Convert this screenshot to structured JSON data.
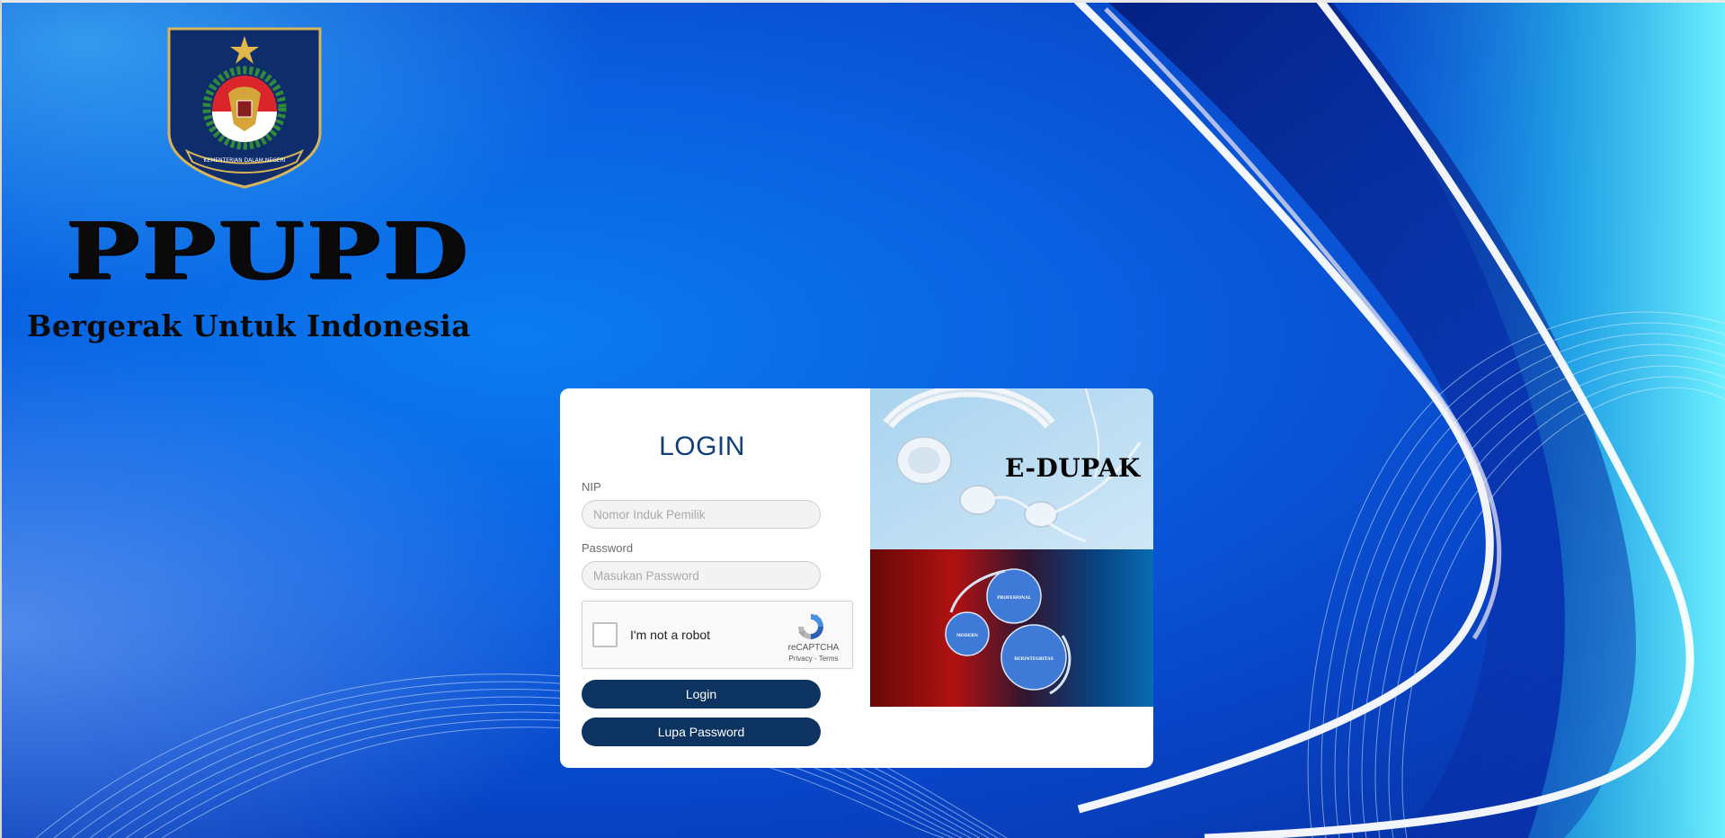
{
  "brand": {
    "title": "PPUPD",
    "subtitle": "Bergerak Untuk Indonesia",
    "emblem_text": "KEMENTERIAN DALAM NEGERI"
  },
  "login": {
    "heading": "LOGIN",
    "nip_label": "NIP",
    "nip_placeholder": "Nomor Induk Pemilik",
    "nip_value": "",
    "password_label": "Password",
    "password_placeholder": "Masukan Password",
    "password_value": "",
    "captcha": {
      "text": "I'm not a robot",
      "brand": "reCAPTCHA",
      "links": "Privacy - Terms",
      "checked": false
    },
    "login_button": "Login",
    "forgot_button": "Lupa Password"
  },
  "side_images": {
    "top_label": "E-DUPAK",
    "gear_labels": [
      "PROFESIONAL",
      "MODERN",
      "BERINTEGRITAS"
    ]
  },
  "colors": {
    "primary_button": "#0d3461",
    "heading": "#123f7a",
    "background": "#0a5fe0"
  },
  "icons": {
    "captcha_logo": "recaptcha-icon",
    "emblem": "garuda-emblem-icon"
  }
}
